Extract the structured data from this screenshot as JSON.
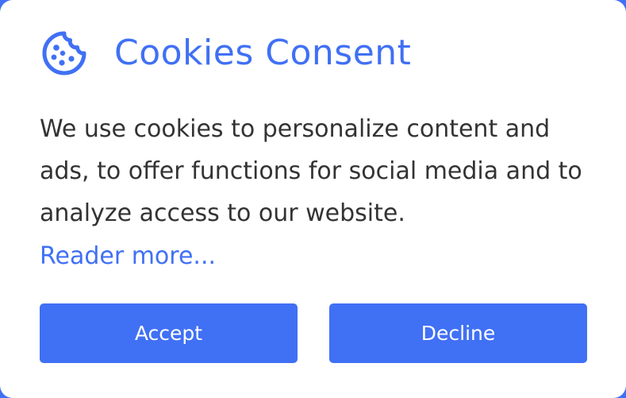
{
  "header": {
    "title": "Cookies Consent",
    "icon": "cookie-icon"
  },
  "body": {
    "message": "We use cookies to personalize content and ads, to offer functions for social media and to analyze access to our website.",
    "read_more_label": "Reader more..."
  },
  "actions": {
    "accept_label": "Accept",
    "decline_label": "Decline"
  },
  "colors": {
    "accent": "#4070F4",
    "background": "#FFFFFF",
    "text": "#333333",
    "button_text": "#FFFFFF"
  }
}
